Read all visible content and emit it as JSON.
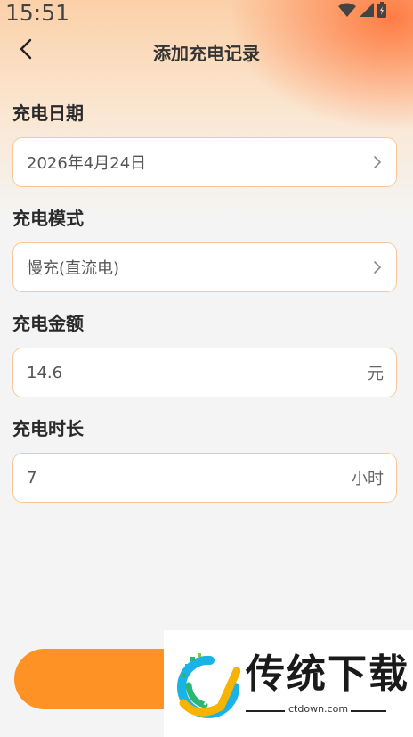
{
  "status_bar": {
    "time": "15:51",
    "icons": [
      "wifi-icon",
      "signal-icon",
      "battery-icon"
    ]
  },
  "header": {
    "title": "添加充电记录",
    "back_icon": "back-arrow-icon"
  },
  "form": {
    "date": {
      "label": "充电日期",
      "value": "2026年4月24日"
    },
    "mode": {
      "label": "充电模式",
      "value": "慢充(直流电)"
    },
    "amount": {
      "label": "充电金额",
      "value": "14.6",
      "unit": "元"
    },
    "duration": {
      "label": "充电时长",
      "value": "7",
      "unit": "小时"
    }
  },
  "watermark": {
    "text": "传统下载",
    "url": "ctdown.com"
  },
  "colors": {
    "accent": "#ff9224",
    "field_border": "#f8c89a",
    "header_gradient": "#fbd0a8"
  }
}
